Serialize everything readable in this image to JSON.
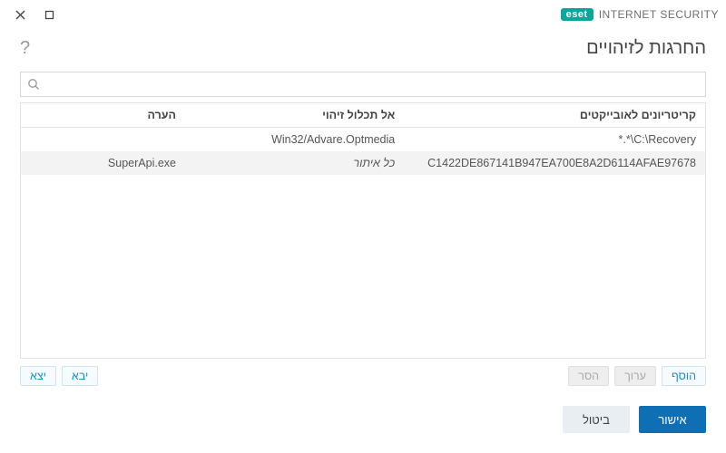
{
  "brand": {
    "badge": "eset",
    "product": "INTERNET SECURITY"
  },
  "page": {
    "title": "החרגות לזיהויים"
  },
  "search": {
    "value": "",
    "placeholder": ""
  },
  "table": {
    "headers": {
      "criteria": "קריטריונים לאובייקטים",
      "detection": "אל תכלול זיהוי",
      "comment": "הערה"
    },
    "rows": [
      {
        "criteria": "*.*\\C:\\Recovery",
        "detection": "Win32/Advare.Optmedia",
        "detection_italic": false,
        "comment": ""
      },
      {
        "criteria": "C1422DE867141B947EA700E8A2D6114AFAE97678",
        "detection": "כל איתור",
        "detection_italic": true,
        "comment": "SuperApi.exe"
      }
    ]
  },
  "toolbar": {
    "add": "הוסף",
    "edit": "ערוך",
    "remove": "הסר",
    "import": "יבא",
    "export": "יצא",
    "edit_enabled": false,
    "remove_enabled": false
  },
  "footer": {
    "ok": "אישור",
    "cancel": "ביטול"
  }
}
